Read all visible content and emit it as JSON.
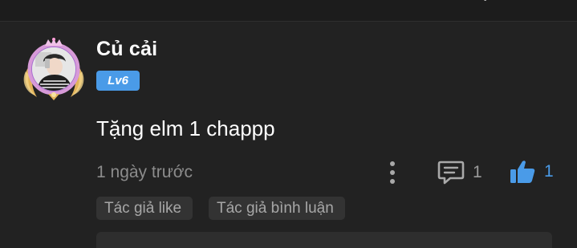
{
  "comment": {
    "username": "Củ cải",
    "level": "Lv6",
    "text": "Tặng elm 1 chappp",
    "timestamp": "1 ngày trước",
    "reply_count": "1",
    "like_count": "1",
    "tags": [
      "Tác giả like",
      "Tác giả bình luận"
    ],
    "icons": {
      "more": "vertical-dots-icon",
      "reply": "comment-bubble-icon",
      "like": "thumbs-up-icon"
    },
    "colors": {
      "background": "#222222",
      "accent": "#4a9be8",
      "muted_text": "#8c8c8c",
      "tag_bg": "#333333"
    }
  }
}
